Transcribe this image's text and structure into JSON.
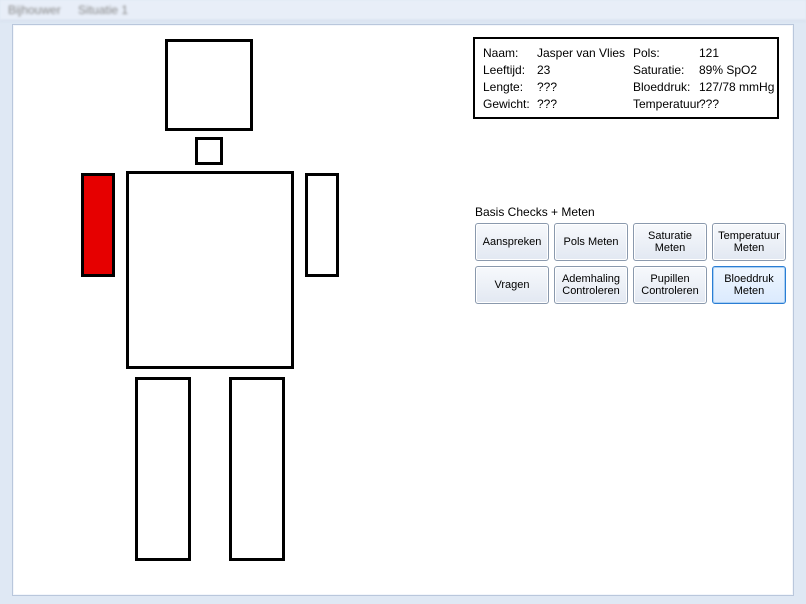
{
  "menu": {
    "item1": "Bijhouwer",
    "item2": "Situatie 1"
  },
  "patient": {
    "labels": {
      "name": "Naam:",
      "age": "Leeftijd:",
      "height": "Lengte:",
      "weight": "Gewicht:",
      "pulse": "Pols:",
      "saturation": "Saturatie:",
      "bloodpressure": "Bloeddruk:",
      "temperature": "Temperatuur"
    },
    "values": {
      "name": "Jasper van Vlies",
      "age": "23",
      "height": "???",
      "weight": "???",
      "pulse": "121",
      "saturation": "89% SpO2",
      "bloodpressure": "127/78 mmHg",
      "temperature": "???"
    }
  },
  "actions": {
    "group_label": "Basis Checks + Meten",
    "buttons": [
      {
        "id": "aanspreken",
        "label": "Aanspreken",
        "selected": false
      },
      {
        "id": "pols-meten",
        "label": "Pols Meten",
        "selected": false
      },
      {
        "id": "saturatie-meten",
        "label": "Saturatie Meten",
        "selected": false
      },
      {
        "id": "temperatuur-meten",
        "label": "Temperatuur Meten",
        "selected": false
      },
      {
        "id": "vragen",
        "label": "Vragen",
        "selected": false
      },
      {
        "id": "ademhaling-controleren",
        "label": "Ademhaling Controleren",
        "selected": false
      },
      {
        "id": "pupillen-controleren",
        "label": "Pupillen Controleren",
        "selected": false
      },
      {
        "id": "bloeddruk-meten",
        "label": "Bloeddruk Meten",
        "selected": true
      }
    ]
  },
  "figure": {
    "injured_part": "right-upper-arm",
    "injury_color": "#e60000"
  }
}
